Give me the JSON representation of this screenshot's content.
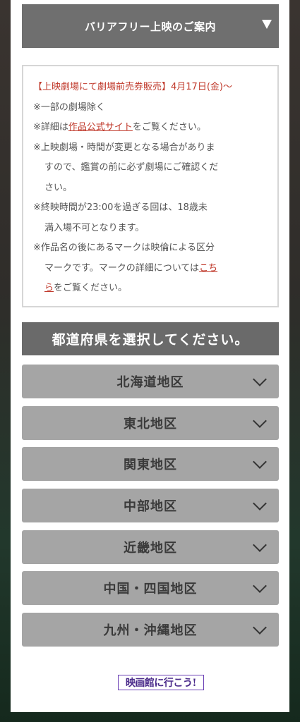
{
  "barrier_free": {
    "label": "バリアフリー上映のご案内"
  },
  "info": {
    "advance_sale": "【上映劇場にて劇場前売券販売】",
    "advance_date": "4月17日(金)〜",
    "note1": "※一部の劇場除く",
    "note2_pre": "※詳細は",
    "note2_link": "作品公式サイト",
    "note2_post": "をご覧ください。",
    "note3_l1": "※上映劇場・時間が変更となる場合がありま",
    "note3_l2": "すので、鑑賞の前に必ず劇場にご確認くだ",
    "note3_l3": "さい。",
    "note4_l1": "※終映時間が23:00を過ぎる回は、18歳未",
    "note4_l2": "満入場不可となります。",
    "note5_l1": "※作品名の後にあるマークは映倫による区分",
    "note5_l2_pre": "マークです。マークの詳細については",
    "note5_link_a": "こち",
    "note5_link_b": "ら",
    "note5_l3_post": "をご覧ください。"
  },
  "pref": {
    "title": "都道府県を選択してください。"
  },
  "regions": [
    {
      "label": "北海道地区"
    },
    {
      "label": "東北地区"
    },
    {
      "label": "関東地区"
    },
    {
      "label": "中部地区"
    },
    {
      "label": "近畿地区"
    },
    {
      "label": "中国・四国地区"
    },
    {
      "label": "九州・沖縄地区"
    }
  ],
  "footer": {
    "logo": "映画館に行こう!"
  }
}
